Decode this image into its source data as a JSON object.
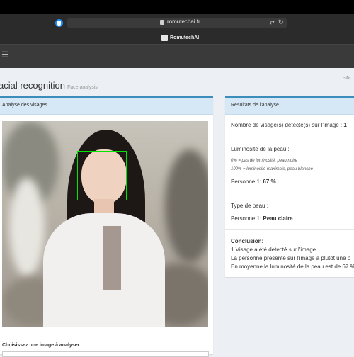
{
  "browser": {
    "url": "romutechai.fr",
    "site_name": "RomutechAI"
  },
  "page": {
    "title": "acial recognition",
    "subtitle": "Face analysis"
  },
  "left_box": {
    "header": "Analyse des visages",
    "file_label": "Choisissez une image à analyser"
  },
  "right_box": {
    "header": "Résultats de l'analyse",
    "faces_label": "Nombre de visage(s) détecté(s) sur l'image : ",
    "faces_value": "1",
    "lum_title": "Luminosité de la peau :",
    "lum_note_1": "0% = pas de luminosité, peau noire",
    "lum_note_2": "100% = luminosité maximale, peau blanche",
    "lum_person_label": "Personne 1: ",
    "lum_person_value": "67 %",
    "type_title": "Type de peau :",
    "type_person_label": "Personne 1: ",
    "type_person_value": "Peau claire",
    "conclusion_title": "Conclusion:",
    "conclusion_1": "1 Visage a été detecté sur l'image.",
    "conclusion_2": "La personne présente sur l'image a plutôt une p",
    "conclusion_3": "En moyenne la luminosité de la peau est de 67 %"
  },
  "colors": {
    "accent": "#3c8dbc",
    "face_box": "#00e600",
    "header_bg": "#d6e8f6"
  }
}
